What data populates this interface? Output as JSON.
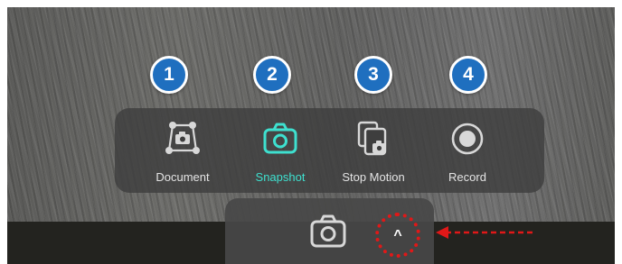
{
  "badges": [
    "1",
    "2",
    "3",
    "4"
  ],
  "modes": [
    {
      "label": "Document",
      "icon": "document-scan-icon",
      "active": false
    },
    {
      "label": "Snapshot",
      "icon": "camera-icon",
      "active": true
    },
    {
      "label": "Stop Motion",
      "icon": "stop-motion-icon",
      "active": false
    },
    {
      "label": "Record",
      "icon": "record-icon",
      "active": false
    }
  ],
  "bottom_bar": {
    "shutter_icon": "camera-icon",
    "expand_icon": "chevron-up-icon",
    "expand_glyph": "^"
  },
  "colors": {
    "active": "#3ee0cf",
    "badge": "#1f6fbf",
    "highlight": "#e01818"
  }
}
